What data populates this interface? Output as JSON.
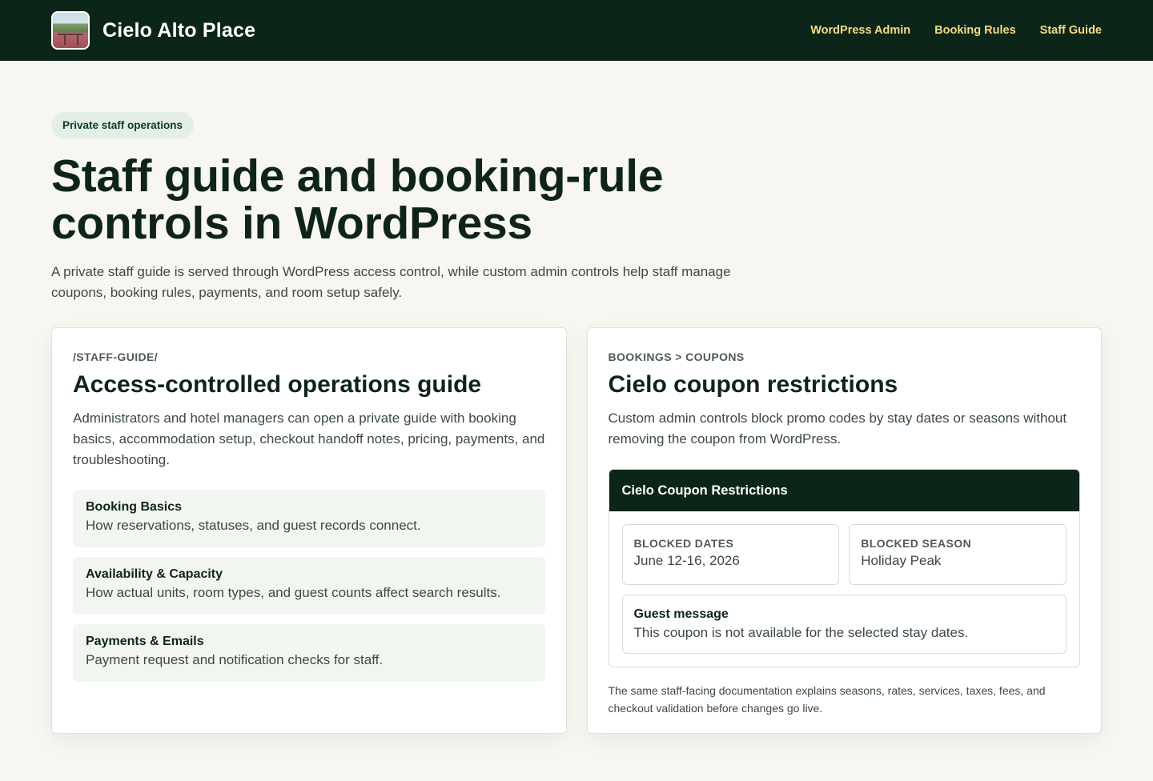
{
  "header": {
    "brand": "Cielo Alto Place",
    "logo_icon": "hotel-photo-icon",
    "nav": [
      {
        "label": "WordPress Admin"
      },
      {
        "label": "Booking Rules"
      },
      {
        "label": "Staff Guide"
      }
    ]
  },
  "hero": {
    "pill": "Private staff operations",
    "title": "Staff guide and booking-rule controls in WordPress",
    "lede": "A private staff guide is served through WordPress access control, while custom admin controls help staff manage coupons, booking rules, payments, and room setup safely."
  },
  "guide_card": {
    "eyebrow": "/STAFF-GUIDE/",
    "title": "Access-controlled operations guide",
    "description": "Administrators and hotel managers can open a private guide with booking basics, accommodation setup, checkout handoff notes, pricing, payments, and troubleshooting.",
    "items": [
      {
        "title": "Booking Basics",
        "desc": "How reservations, statuses, and guest records connect."
      },
      {
        "title": "Availability & Capacity",
        "desc": "How actual units, room types, and guest counts affect search results."
      },
      {
        "title": "Payments & Emails",
        "desc": "Payment request and notification checks for staff."
      }
    ]
  },
  "coupon_card": {
    "eyebrow": "BOOKINGS > COUPONS",
    "title": "Cielo coupon restrictions",
    "description": "Custom admin controls block promo codes by stay dates or seasons without removing the coupon from WordPress.",
    "panel": {
      "title": "Cielo Coupon Restrictions",
      "blocked_dates_label": "BLOCKED DATES",
      "blocked_dates_value": "June 12-16, 2026",
      "blocked_season_label": "BLOCKED SEASON",
      "blocked_season_value": "Holiday Peak",
      "guest_message_label": "Guest message",
      "guest_message_value": "This coupon is not available for the selected stay dates."
    },
    "note": "The same staff-facing documentation explains seasons, rates, services, taxes, fees, and checkout validation before changes go live."
  },
  "colors": {
    "header_bg": "#0c2519",
    "nav_link": "#f5dc86",
    "page_bg": "#f7f6f1",
    "pill_bg": "#e3efe6"
  }
}
